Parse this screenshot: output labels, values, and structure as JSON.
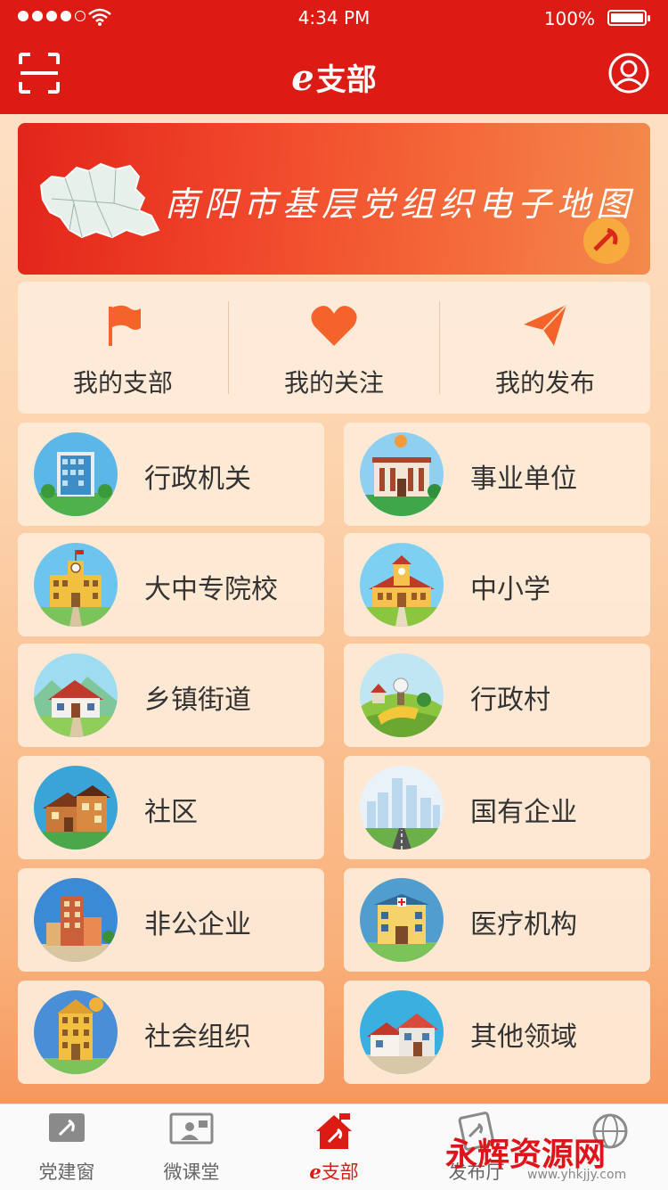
{
  "status_bar": {
    "time": "4:34 PM",
    "battery": "100%"
  },
  "nav": {
    "title_prefix": "e",
    "title": "支部"
  },
  "banner": {
    "text": "南阳市基层党组织电子地图"
  },
  "quick_actions": [
    {
      "label": "我的支部",
      "icon": "flag-icon"
    },
    {
      "label": "我的关注",
      "icon": "heart-icon"
    },
    {
      "label": "我的发布",
      "icon": "paper-plane-icon"
    }
  ],
  "categories": [
    {
      "label": "行政机关",
      "icon": "government-building-icon"
    },
    {
      "label": "事业单位",
      "icon": "institution-building-icon"
    },
    {
      "label": "大中专院校",
      "icon": "college-icon"
    },
    {
      "label": "中小学",
      "icon": "school-icon"
    },
    {
      "label": "乡镇街道",
      "icon": "town-street-icon"
    },
    {
      "label": "行政村",
      "icon": "village-icon"
    },
    {
      "label": "社区",
      "icon": "community-icon"
    },
    {
      "label": "国有企业",
      "icon": "state-enterprise-icon"
    },
    {
      "label": "非公企业",
      "icon": "private-enterprise-icon"
    },
    {
      "label": "医疗机构",
      "icon": "hospital-icon"
    },
    {
      "label": "社会组织",
      "icon": "social-organization-icon"
    },
    {
      "label": "其他领域",
      "icon": "other-field-icon"
    }
  ],
  "tabs": [
    {
      "label": "党建窗",
      "icon": "party-window-icon",
      "active": false
    },
    {
      "label": "微课堂",
      "icon": "micro-class-icon",
      "active": false
    },
    {
      "label": "支部",
      "prefix": "e",
      "icon": "branch-home-icon",
      "active": true
    },
    {
      "label": "发布厅",
      "icon": "publish-hall-icon",
      "active": false
    },
    {
      "label": "",
      "icon": "globe-icon",
      "active": false
    }
  ],
  "watermark": {
    "text": "永辉资源网",
    "url": "www.yhkjjy.com"
  },
  "colors": {
    "primary_red": "#dc1c14",
    "accent_orange": "#f4642a"
  }
}
